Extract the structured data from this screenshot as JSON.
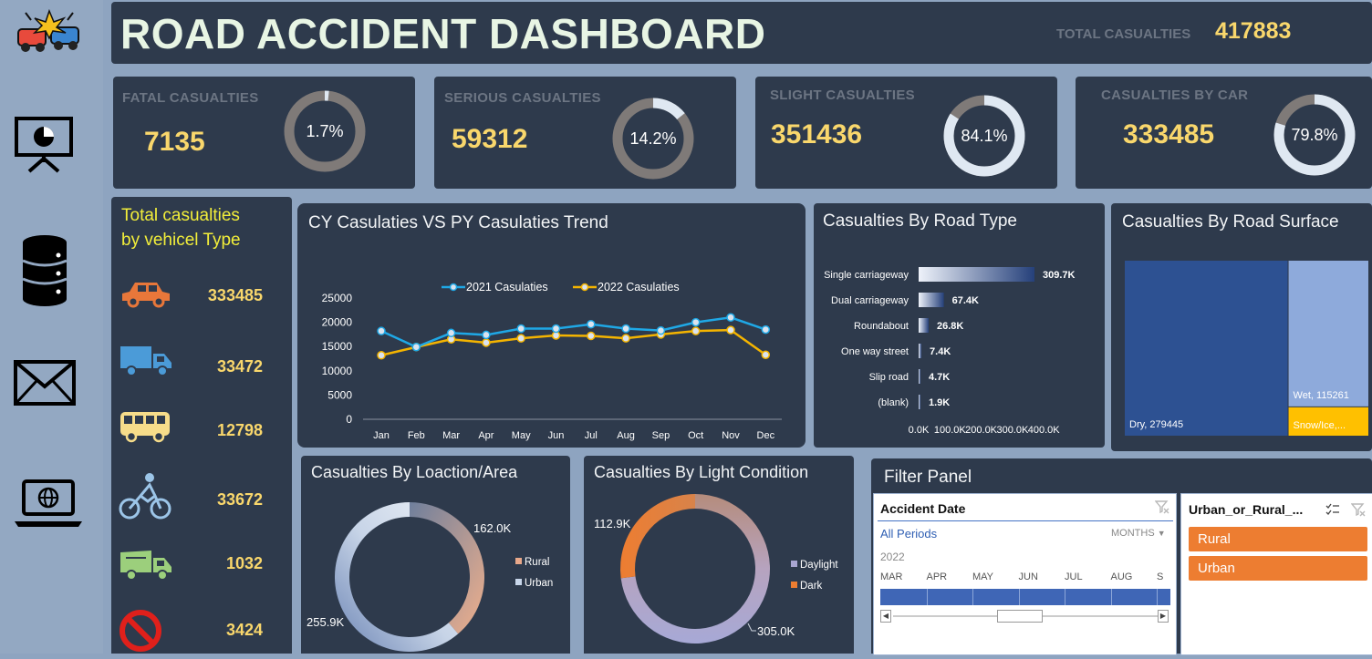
{
  "header": {
    "title": "ROAD ACCIDENT DASHBOARD",
    "total_label": "TOTAL CASUALTIES",
    "total_value": "417883"
  },
  "sidebar": {
    "icons": [
      "car-crash-icon",
      "presentation-chart-icon",
      "database-icon",
      "mail-icon",
      "laptop-globe-icon"
    ]
  },
  "kpis": [
    {
      "label": "FATAL  CASUALTIES",
      "value": "7135",
      "pct_text": "1.7%",
      "pct": 0.017
    },
    {
      "label": "SERIOUS  CASUALTIES",
      "value": "59312",
      "pct_text": "14.2%",
      "pct": 0.142
    },
    {
      "label": "SLIGHT  CASUALTIES",
      "value": "351436",
      "pct_text": "84.1%",
      "pct": 0.841
    },
    {
      "label": "CASUALTIES BY CAR",
      "value": "333485",
      "pct_text": "79.8%",
      "pct": 0.798
    }
  ],
  "vehicles": {
    "title_line1": "Total casualties",
    "title_line2": "by vehicel Type",
    "items": [
      {
        "icon": "car-icon",
        "value": "333485",
        "color": "#e8773a"
      },
      {
        "icon": "truck-icon",
        "value": "33472",
        "color": "#4b9bd8"
      },
      {
        "icon": "bus-icon",
        "value": "12798",
        "color": "#f6dc8a"
      },
      {
        "icon": "bicycle-icon",
        "value": "33672",
        "color": "#9cc5e8"
      },
      {
        "icon": "dump-truck-icon",
        "value": "1032",
        "color": "#9ccf7c"
      },
      {
        "icon": "no-entry-icon",
        "value": "3424",
        "color": "#e0201b"
      }
    ]
  },
  "colors": {
    "accent_yellow": "#f9d76c",
    "series_2021": "#1fa8e6",
    "series_2022": "#f4b400",
    "rural": "#e8a88a",
    "urban": "#c8d6ea",
    "dark_orange": "#ed7d31",
    "daylight": "#a9a6d2"
  },
  "trend": {
    "title": "CY Casulaties VS  PY Casulaties Trend"
  },
  "road_type": {
    "title": "Casualties By Road Type"
  },
  "surface": {
    "title": "Casualties By Road Surface"
  },
  "location": {
    "title": "Casualties By Loaction/Area"
  },
  "light": {
    "title": "Casualties By Light Condition"
  },
  "filter": {
    "title": "Filter Panel",
    "date_slicer_title": "Accident Date",
    "period_text": "All Periods",
    "months_label": "MONTHS",
    "year_label": "2022",
    "month_labels": [
      "MAR",
      "APR",
      "MAY",
      "JUN",
      "JUL",
      "AUG",
      "S"
    ],
    "urban_slicer_title": "Urban_or_Rural_...",
    "urban_options": [
      "Rural",
      "Urban"
    ]
  },
  "chart_data": [
    {
      "type": "line",
      "title": "CY Casulaties VS  PY Casulaties Trend",
      "categories": [
        "Jan",
        "Feb",
        "Mar",
        "Apr",
        "May",
        "Jun",
        "Jul",
        "Aug",
        "Sep",
        "Oct",
        "Nov",
        "Dec"
      ],
      "series": [
        {
          "name": "2021 Casulaties",
          "values": [
            18200,
            14900,
            17800,
            17400,
            18700,
            18700,
            19600,
            18700,
            18300,
            20000,
            21000,
            18500
          ]
        },
        {
          "name": "2022 Casulaties",
          "values": [
            13200,
            14900,
            16500,
            15800,
            16700,
            17300,
            17200,
            16700,
            17500,
            18200,
            18400,
            13300
          ]
        }
      ],
      "yticks": [
        0,
        5000,
        10000,
        15000,
        20000,
        25000
      ],
      "ylim": [
        0,
        25000
      ]
    },
    {
      "type": "bar",
      "orientation": "horizontal",
      "title": "Casualties By Road Type",
      "categories": [
        "Single carriageway",
        "Dual carriageway",
        "Roundabout",
        "One way street",
        "Slip road",
        "(blank)"
      ],
      "values": [
        309700,
        67400,
        26800,
        7400,
        4700,
        1900
      ],
      "data_labels": [
        "309.7K",
        "67.4K",
        "26.8K",
        "7.4K",
        "4.7K",
        "1.9K"
      ],
      "xticks": [
        "0.0K",
        "100.0K",
        "200.0K",
        "300.0K",
        "400.0K"
      ],
      "xlim": [
        0,
        400000
      ]
    },
    {
      "type": "treemap",
      "title": "Casualties By Road Surface",
      "labels": [
        "Dry, 279445",
        "Wet, 115261",
        "Snow/Ice,..."
      ],
      "values": [
        279445,
        115261,
        23177
      ]
    },
    {
      "type": "pie",
      "variant": "donut",
      "title": "Casualties By Loaction/Area",
      "labels": [
        "Rural",
        "Urban"
      ],
      "values": [
        162000,
        255900
      ],
      "data_labels": [
        "162.0K",
        "255.9K"
      ]
    },
    {
      "type": "pie",
      "variant": "donut",
      "title": "Casualties By Light Condition",
      "labels": [
        "Daylight",
        "Dark"
      ],
      "values": [
        305000,
        112900
      ],
      "data_labels": [
        "305.0K",
        "112.9K"
      ]
    }
  ]
}
